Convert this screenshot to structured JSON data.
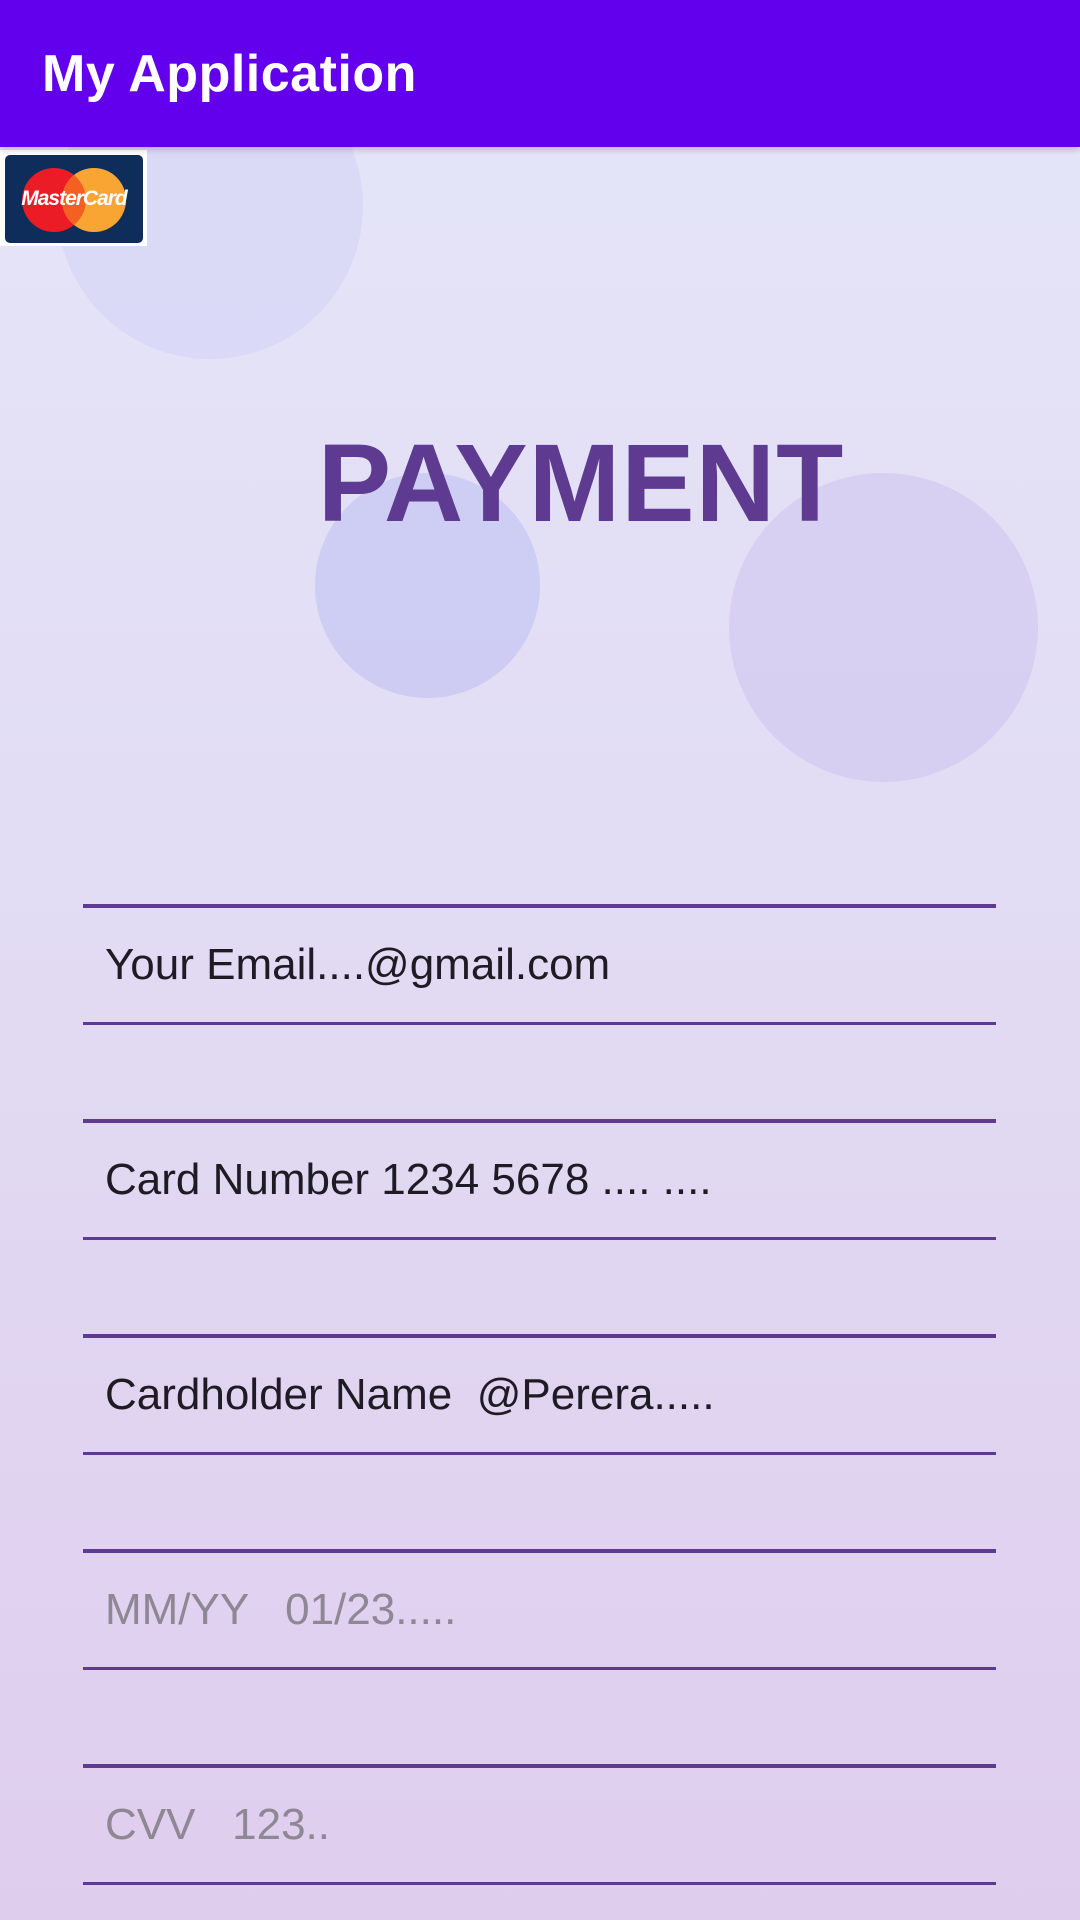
{
  "app_bar": {
    "title": "My Application",
    "color": "#6200EE"
  },
  "card_logo": {
    "brand": "MasterCard",
    "icon": "mastercard-icon"
  },
  "heading": "PAYMENT",
  "fields": [
    {
      "value": "Your Email....@gmail.com",
      "placeholder": ""
    },
    {
      "value": "Card Number 1234 5678 .... ....",
      "placeholder": ""
    },
    {
      "value": "Cardholder Name  @Perera.....",
      "placeholder": ""
    },
    {
      "value": "",
      "placeholder": "MM/YY   01/23....."
    },
    {
      "value": "",
      "placeholder": "CVV   123.."
    }
  ],
  "colors": {
    "accent": "#5E3B91",
    "text": "#1E1B24",
    "hint": "#8E8794"
  }
}
